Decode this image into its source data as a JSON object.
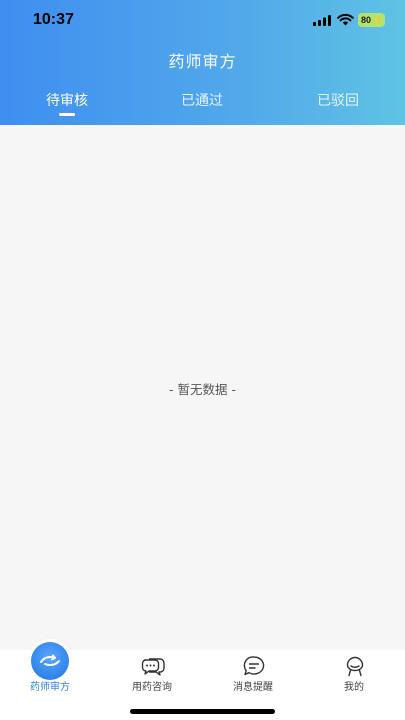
{
  "status_bar": {
    "time": "10:37",
    "battery": "80"
  },
  "header": {
    "title": "药师审方"
  },
  "tabs": [
    {
      "label": "待审核",
      "active": true
    },
    {
      "label": "已通过",
      "active": false
    },
    {
      "label": "已驳回",
      "active": false
    }
  ],
  "content": {
    "empty_text": "- 暂无数据 -"
  },
  "tabbar": [
    {
      "label": "药师审方",
      "icon": "pharmacist-icon",
      "active": true
    },
    {
      "label": "用药咨询",
      "icon": "chat-bubbles-icon",
      "active": false
    },
    {
      "label": "消息提醒",
      "icon": "message-icon",
      "active": false
    },
    {
      "label": "我的",
      "icon": "user-icon",
      "active": false
    }
  ],
  "colors": {
    "accent": "#2f7fd9",
    "header_start": "#3f8ef0",
    "header_end": "#5fc3e4"
  }
}
